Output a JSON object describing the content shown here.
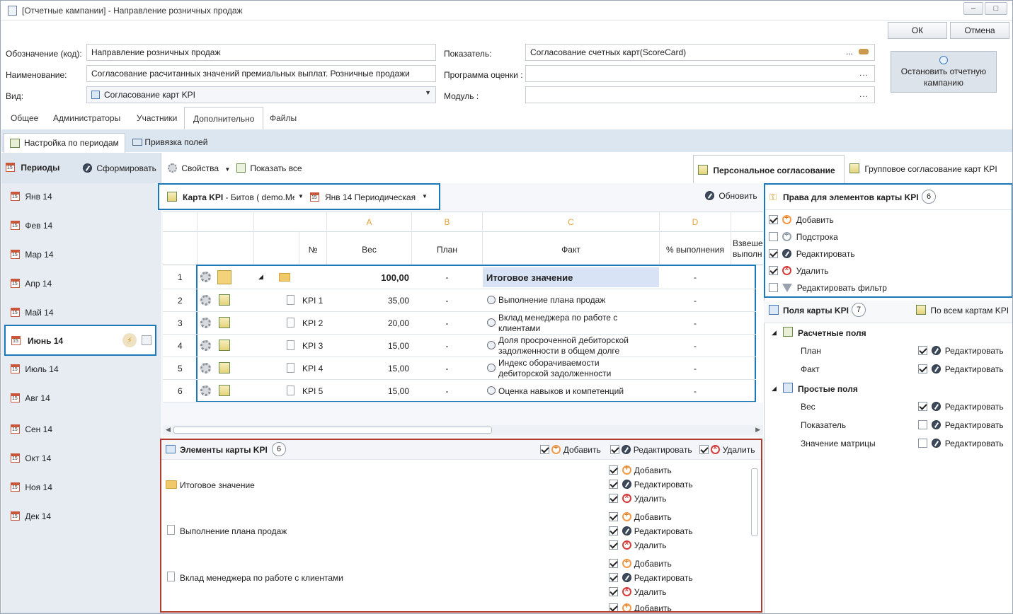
{
  "window": {
    "title": "[Отчетные кампании] - Направление розничных продаж",
    "ok": "ОК",
    "cancel": "Отмена"
  },
  "form": {
    "code_label": "Обозначение (код):",
    "code_value": "Направление розничных продаж",
    "name_label": "Наименование:",
    "name_value": "Согласование расчитанных значений премиальных выплат. Розничные продажи",
    "type_label": "Вид:",
    "type_value": "Согласование карт KPI",
    "indicator_label": "Показатель:",
    "indicator_value": "Согласование счетных карт(ScoreCard)",
    "program_label": "Программа оценки :",
    "program_value": "",
    "module_label": "Модуль :",
    "module_value": "",
    "dots": "...",
    "stop_button": "Остановить отчетную кампанию"
  },
  "tabs": [
    "Общее",
    "Администраторы",
    "Участники",
    "Дополнительно",
    "Файлы"
  ],
  "subtabs": [
    "Настройка по периодам",
    "Привязка полей"
  ],
  "periods": {
    "title": "Периоды",
    "form_button": "Сформировать",
    "items": [
      "Янв 14",
      "Фев 14",
      "Мар 14",
      "Апр 14",
      "Май 14",
      "Июнь 14",
      "Июль 14",
      "Авг 14",
      "Сен 14",
      "Окт 14",
      "Ноя 14",
      "Дек 14"
    ],
    "selected": "Июнь 14"
  },
  "toolbar": {
    "properties": "Свойства",
    "show_all": "Показать все",
    "personal": "Персональное согласование",
    "group": "Групповое согласование карт KPI",
    "refresh": "Обновить"
  },
  "card": {
    "label": "Карта KPI",
    "owner": " - Битов ( demo.Me",
    "period": "Янв 14  Периодическая"
  },
  "grid": {
    "letters": [
      "A",
      "B",
      "C",
      "D"
    ],
    "headers": {
      "num": "№",
      "weight": "Вес",
      "plan": "План",
      "fact": "Факт",
      "pct": "% выполнения",
      "weighted": "Взвешенный выполнения"
    },
    "rows": [
      {
        "n": "1",
        "code": "",
        "weight": "100,00",
        "plan": "-",
        "fact": "Итоговое значение",
        "pct": "-"
      },
      {
        "n": "2",
        "code": "KPI 1",
        "weight": "35,00",
        "plan": "-",
        "fact": "Выполнение плана продаж",
        "pct": "-"
      },
      {
        "n": "3",
        "code": "KPI 2",
        "weight": "20,00",
        "plan": "-",
        "fact": "Вклад менеджера по работе с клиентами",
        "pct": "-"
      },
      {
        "n": "4",
        "code": "KPI 3",
        "weight": "15,00",
        "plan": "-",
        "fact": "Доля просроченной дебиторской задолженности в общем долге",
        "pct": "-"
      },
      {
        "n": "5",
        "code": "KPI 4",
        "weight": "15,00",
        "plan": "-",
        "fact": "Индекс оборачиваемости дебиторской задолженности",
        "pct": "-"
      },
      {
        "n": "6",
        "code": "KPI 5",
        "weight": "15,00",
        "plan": "-",
        "fact": "Оценка навыков и компетенций",
        "pct": "-"
      }
    ]
  },
  "elements": {
    "title": "Элементы карты KPI",
    "count": "6",
    "add": "Добавить",
    "edit": "Редактировать",
    "del": "Удалить",
    "items": [
      "Итоговое значение",
      "Выполнение плана продаж",
      "Вклад менеджера по работе с клиентами"
    ]
  },
  "rights": {
    "title": "Права для элементов карты KPI",
    "count": "6",
    "items": [
      "Добавить",
      "Подстрока",
      "Редактировать",
      "Удалить",
      "Редактировать фильтр"
    ],
    "checked": [
      true,
      false,
      true,
      true,
      false
    ]
  },
  "fields": {
    "title": "Поля карты KPI",
    "count": "7",
    "all_cards": "По всем картам KPI",
    "edit": "Редактировать",
    "calc_group": "Расчетные поля",
    "calc": [
      "План",
      "Факт"
    ],
    "calc_checked": [
      true,
      true
    ],
    "simple_group": "Простые поля",
    "simple": [
      "Вес",
      "Показатель",
      "Значение матрицы"
    ],
    "simple_checked": [
      true,
      false,
      false
    ]
  },
  "colors": {
    "accent": "#1a78b8",
    "highlight": "#b03a2e",
    "band": "#dce6f0",
    "selection": "#d8e4f5"
  }
}
